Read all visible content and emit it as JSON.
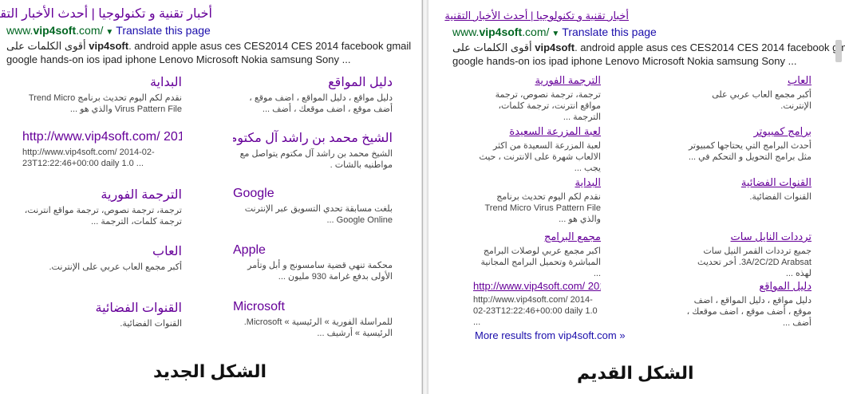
{
  "new_layout": {
    "result_title": "أخبار تقنية و تكنولوجيا | أحدث الأخبار التقنية",
    "url": "www.vip4soft.com/",
    "url_bold": "vip4soft",
    "translate": "Translate this page",
    "snippet_line1": "أقوى الكلمات على vip4soft. android apple asus ces CES2014 CES 2014 facebook gmail",
    "snippet_line2": "google hands-on ios ipad iphone Lenovo Microsoft Nokia samsung Sony ...",
    "sitelinks": [
      {
        "title": "دليل المواقع",
        "snippet": "دليل مواقع ، دليل المواقع ، اضف موقع ، أضف موقع ، اضف موقعك ، أضف ..."
      },
      {
        "title": "البداية",
        "snippet": "نقدم لكم اليوم تحديث برنامج Trend Micro Virus Pattern File والذي هو ..."
      },
      {
        "title": "الشيخ محمد بن راشد آل مكتوم ...",
        "snippet": "الشيخ محمد بن راشد آل مكتوم يتواصل مع مواطنيه بالشات ."
      },
      {
        "title": "http://www.vip4soft.com/ 201...",
        "snippet": "http://www.vip4soft.com/ 2014-02-23T12:22:46+00:00 daily 1.0 ..."
      },
      {
        "title": "Google",
        "snippet": "بلغت مسابقة تحدي التسويق عبر الإنترنت Google Online ..."
      },
      {
        "title": "الترجمة الفورية",
        "snippet": "ترجمة، ترجمة نصوص، ترجمة مواقع انترنت، ترجمة كلمات، الترجمة ..."
      },
      {
        "title": "Apple",
        "snippet": "محكمة تنهي قضية سامسونج و أبل وتأمر الأولى بدفع غرامة 930 مليون ..."
      },
      {
        "title": "العاب",
        "snippet": "أكبر مجمع العاب عربي على الإنترنت."
      },
      {
        "title": "Microsoft",
        "snippet": "للمراسلة الفورية » الرئيسية » Microsoft. الرئيسية » أرشيف ..."
      },
      {
        "title": "القنوات الفضائية",
        "snippet": "القنوات الفضائية."
      }
    ],
    "caption": "الشكل الجديد"
  },
  "old_layout": {
    "result_title": "أخبار تقنية و تكنولوجيا | أحدث الأخبار التقنية",
    "url": "www.vip4soft.com/",
    "url_bold": "vip4soft",
    "translate": "Translate this page",
    "snippet_line1": "أقوى الكلمات على vip4soft. android apple asus ces CES2014 CES 2014 facebook gmail",
    "snippet_line2": "google hands-on ios ipad iphone Lenovo Microsoft Nokia samsung Sony ...",
    "sitelinks": [
      {
        "title": "العاب",
        "snippet": "أكبر مجمع العاب عربي على الإنترنت."
      },
      {
        "title": "الترجمة الفورية",
        "snippet": "ترجمة، ترجمة نصوص، ترجمة مواقع انترنت، ترجمة كلمات، الترجمة ..."
      },
      {
        "title": "برامج كمبيوتر",
        "snippet": "أحدث البرامج التي يحتاجها كمبيوتر مثل برامج التحويل و التحكم في ..."
      },
      {
        "title": "لعبة المزرعة السعيدة",
        "snippet": "لعبة المزرعة السعيدة من اكثر الالعاب شهرة على الانترنت ، حيث يجب ..."
      },
      {
        "title": "القنوات الفضائية",
        "snippet": "القنوات الفضائية."
      },
      {
        "title": "البداية",
        "snippet": "نقدم لكم اليوم تحديث برنامج Trend Micro Virus Pattern File والذي هو ..."
      },
      {
        "title": "ترددات النايل سات",
        "snippet": "جميع ترددات القمر النيل سات 3A/2C/2D Arabsat. أخر تحديث لهذه ..."
      },
      {
        "title": "مجمع البرامج",
        "snippet": "اكبر مجمع عربي لوصلات البرامج المباشرة وتحميل البرامج المجانية ..."
      },
      {
        "title": "دليل المواقع",
        "snippet": "دليل مواقع ، دليل المواقع ، اضف موقع ، أضف موقع ، اضف موقعك ، أضف ..."
      },
      {
        "title": "http://www.vip4soft.com/ 2014 ...",
        "snippet": "http://www.vip4soft.com/ 2014-02-23T12:22:46+00:00 daily 1.0 ..."
      }
    ],
    "more_results": "More results from vip4soft.com »",
    "caption": "الشكل القديم"
  },
  "colors": {
    "link": "#1a0dab",
    "visited": "#660099",
    "url_green": "#006621"
  }
}
